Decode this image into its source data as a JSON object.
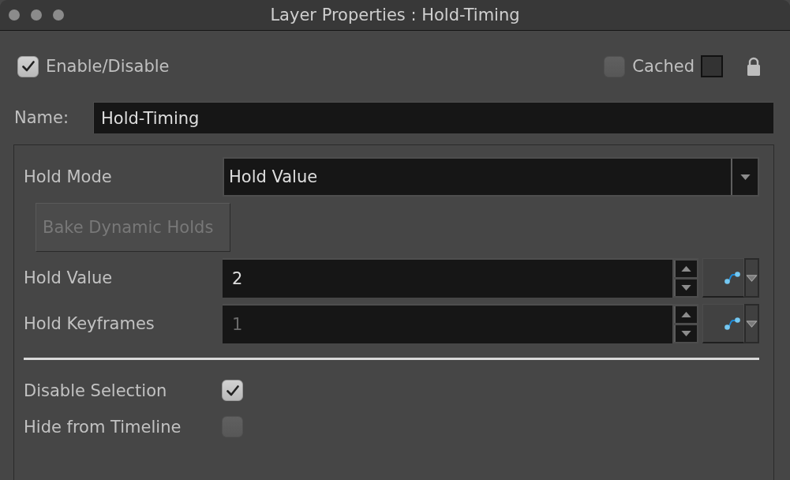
{
  "window": {
    "title": "Layer Properties : Hold-Timing"
  },
  "enable": {
    "label": "Enable/Disable",
    "checked": true
  },
  "cached": {
    "label": "Cached",
    "checked": false
  },
  "name_field": {
    "label": "Name:",
    "value": "Hold-Timing"
  },
  "hold_mode": {
    "label": "Hold Mode",
    "value": "Hold Value"
  },
  "bake_button": {
    "label": "Bake Dynamic Holds",
    "disabled": true
  },
  "fields": [
    {
      "label": "Hold Value",
      "value": "2",
      "disabled": false
    },
    {
      "label": "Hold Keyframes",
      "value": "1",
      "disabled": true
    }
  ],
  "options": [
    {
      "label": "Disable Selection",
      "checked": true
    },
    {
      "label": "Hide from Timeline",
      "checked": false
    }
  ]
}
